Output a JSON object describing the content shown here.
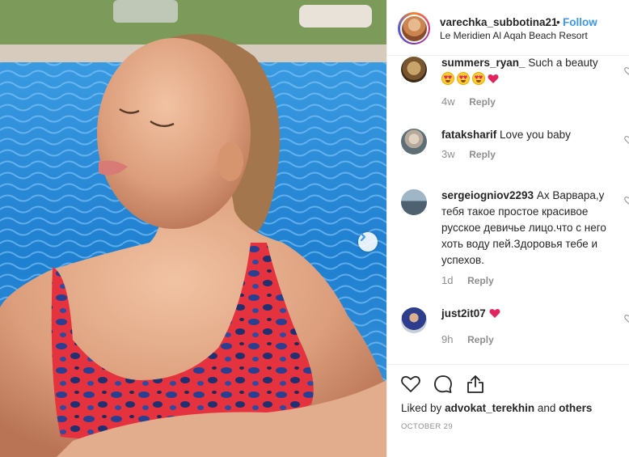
{
  "post": {
    "username": "varechka_subbotina21",
    "separator": "•",
    "follow_label": "Follow",
    "location": "Le Meridien Al Aqah Beach Resort"
  },
  "comments": [
    {
      "user": "summers_ryan_",
      "text": "Such a beauty",
      "emoji": "star-struck-emoji x3, red-heart",
      "age": "4w",
      "reply": "Reply"
    },
    {
      "user": "fataksharif",
      "text": "Love you baby",
      "age": "3w",
      "reply": "Reply"
    },
    {
      "user": "sergeiogniov2293",
      "text": "Ах Варвара,у тебя такое простое красивое русское девичье лицо.что с него хоть воду пей.Здоровья тебе и успехов.",
      "age": "1d",
      "reply": "Reply"
    },
    {
      "user": "just2it07",
      "text": "",
      "emoji": "red-heart",
      "age": "9h",
      "reply": "Reply"
    }
  ],
  "footer": {
    "liked_prefix": "Liked by",
    "liked_user": "advokat_terekhin",
    "liked_and": "and",
    "liked_others": "others",
    "date": "OCTOBER 29"
  },
  "colors": {
    "link": "#3897f0",
    "muted": "#8e8e8e",
    "text": "#262626",
    "heart": "#ed4956"
  },
  "icons": [
    "chevron-right-icon",
    "heart-icon",
    "comment-icon",
    "share-icon"
  ]
}
